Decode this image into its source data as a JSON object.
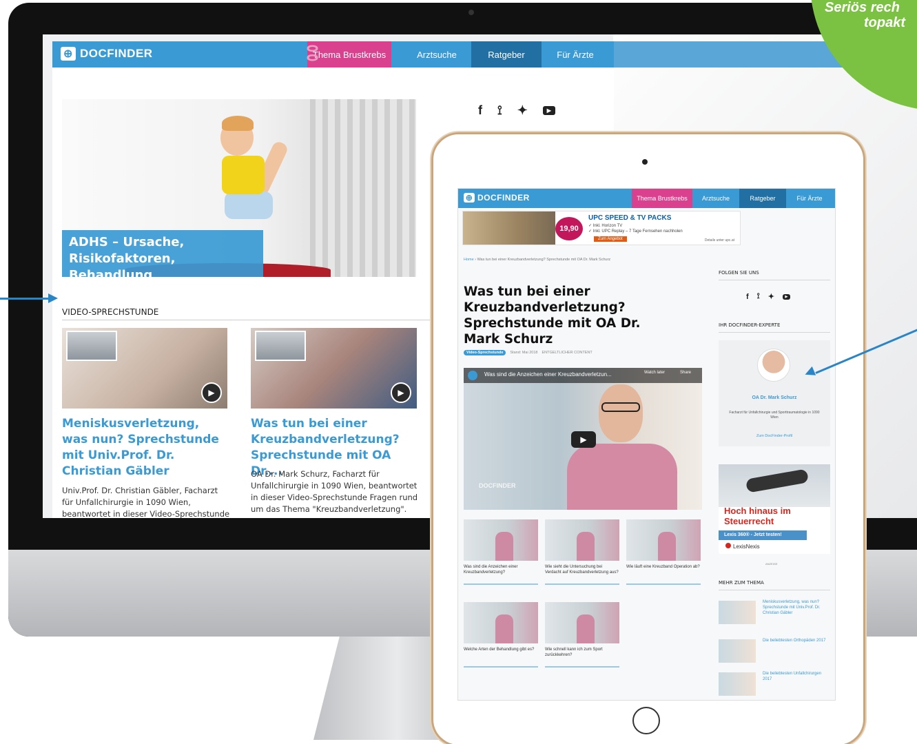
{
  "promo": {
    "line1": "Seriös rech",
    "line2": "topakt"
  },
  "colors": {
    "brand_blue": "#3a9ad4",
    "nav_dark": "#226fa3",
    "pink": "#d9418f",
    "promo_green": "#7cc242",
    "arrow_blue": "#2a85c7"
  },
  "desktop": {
    "logo": {
      "icon": "plus-box-icon",
      "text": "DocFinder"
    },
    "nav": [
      "Thema Brustkrebs",
      "Arztsuche",
      "Ratgeber",
      "Für Ärzte"
    ],
    "hero_caption": "ADHS – Ursache, Risikofaktoren, Behandlung",
    "social_icons": [
      "facebook-icon",
      "rss-icon",
      "twitter-icon",
      "youtube-icon"
    ],
    "section_title": "VIDEO-SPRECHSTUNDE",
    "cards": [
      {
        "title": "Meniskusverletzung, was nun? Sprechstunde mit Univ.Prof. Dr. Christian Gäbler",
        "text": "Univ.Prof. Dr. Christian Gäbler, Facharzt für Unfallchirurgie in 1090 Wien, beantwortet in dieser Video-Sprechstunde Fragen rund um"
      },
      {
        "title": "Was tun bei einer Kreuzbandverletzung? Sprechstunde mit OA Dr....",
        "text": "OA Dr. Mark Schurz, Facharzt für Unfallchirurgie in 1090 Wien, beantwortet in dieser Video-Sprechstunde Fragen rund um das Thema \"Kreuzbandverletzung\"."
      }
    ]
  },
  "tablet": {
    "logo": {
      "text": "DocFinder"
    },
    "nav": [
      "Thema Brustkrebs",
      "Arztsuche",
      "Ratgeber",
      "Für Ärzte"
    ],
    "ad": {
      "price": "19,90",
      "title": "UPC SPEED & TV PACKS",
      "line1": "✓ Inkl. Horizon TV",
      "line2": "✓ Inkl. UPC Replay – 7 Tage Fernsehen nachholen",
      "button": "Zum Angebot",
      "fine": "Details unter upc.at"
    },
    "breadcrumb": {
      "home": "Home",
      "rest": "› Was tun bei einer Kreuzbandverletzung? Sprechstunde mit OA Dr. Mark Schurz"
    },
    "headline": "Was tun bei einer Kreuzbandverletzung? Sprechstunde mit OA Dr. Mark Schurz",
    "tag": "Video-Sprechstunde",
    "date": "Stand: Mai 2018",
    "content_label": "ENTGELTLICHER CONTENT",
    "video": {
      "title": "Was sind die Anzeichen einer Kreuzbandverletzun...",
      "watch_later": "Watch later",
      "share": "Share",
      "watermark": "DOCFINDER"
    },
    "thumbs": [
      "Was sind die Anzeichen einer Kreuzbandverletzung?",
      "Wie sieht die Untersuchung bei Verdacht auf Kreuzbandverletzung aus?",
      "Wie läuft eine Kreuzband Operation ab?",
      "Welche Arten der Behandlung gibt es?",
      "Wie schnell kann ich zum Sport zurückkehren?"
    ],
    "sidebar": {
      "follow_title": "FOLGEN SIE UNS",
      "expert_title": "IHR DOCFINDER-EXPERTE",
      "expert_name": "OA Dr. Mark Schurz",
      "expert_desc": "Facharzt für Unfallchirurgie und Sporttraumatologie in 1090 Wien",
      "expert_link": "Zum DocFinder-Profil",
      "ad_headline": "Hoch hinaus im Steuerrecht",
      "ad_cta": "Lexis 360® - Jetzt testen!",
      "ad_brand": "LexisNexis",
      "ad_label": "ANZEIGE",
      "more_title": "MEHR ZUM THEMA",
      "more_items": [
        "Meniskusverletzung, was nun? Sprechstunde mit Univ.Prof. Dr. Christian Gäbler",
        "Die beliebtesten Orthopäden 2017",
        "Die beliebtesten Unfallchirurgen 2017"
      ]
    }
  }
}
